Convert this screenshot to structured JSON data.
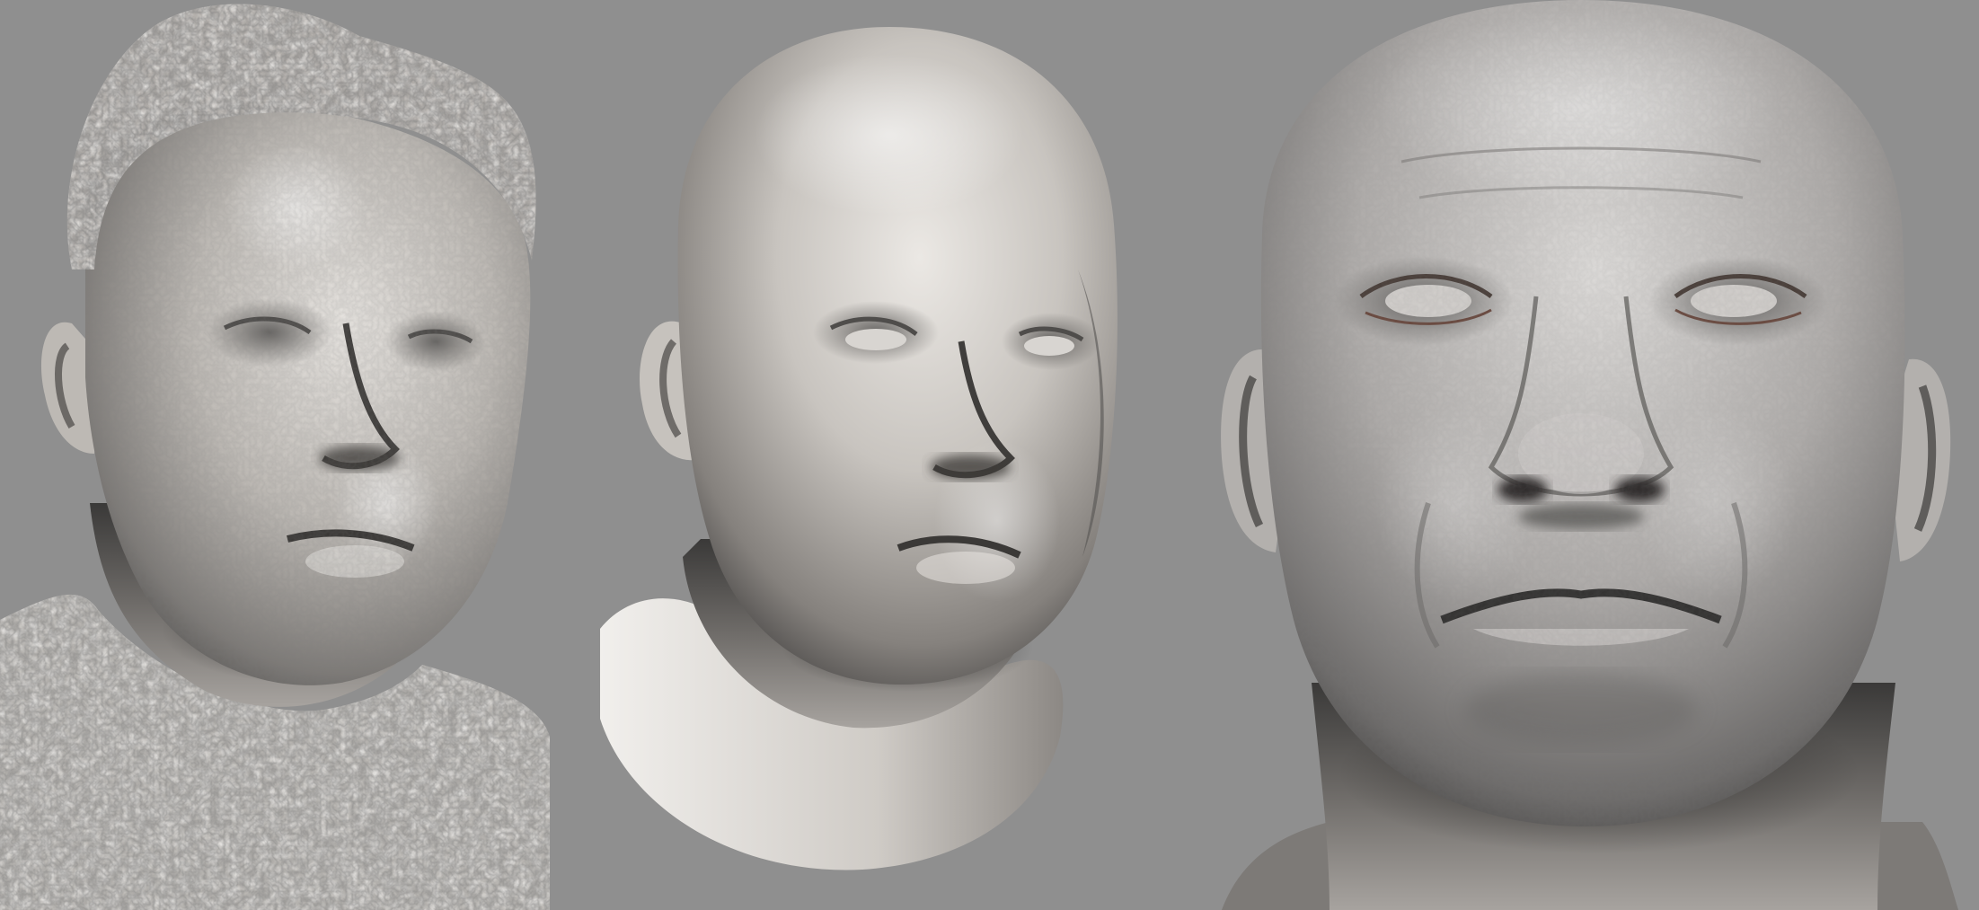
{
  "image": {
    "background_color": "#8f8f8f",
    "material_color": "#c9c6c3",
    "description_hidden": true,
    "models": [
      {
        "id": "raw-scan",
        "kind": "raw 3D scan with noisy hair and shirt"
      },
      {
        "id": "clean-sculpt",
        "kind": "cleaned head sculpt with neck cutoff"
      },
      {
        "id": "detailed-sculpt",
        "kind": "high-detail frontal head sculpt"
      }
    ]
  }
}
